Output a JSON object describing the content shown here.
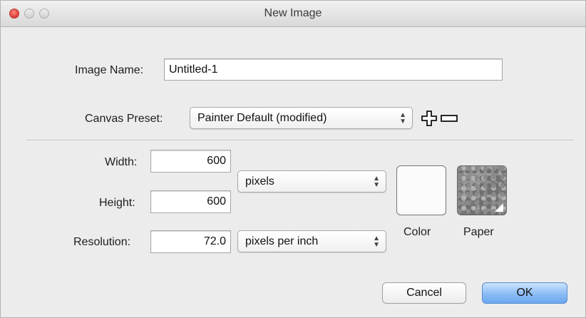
{
  "window": {
    "title": "New Image"
  },
  "form": {
    "image_name_label": "Image Name:",
    "image_name_value": "Untitled-1",
    "canvas_preset_label": "Canvas Preset:",
    "canvas_preset_value": "Painter Default (modified)",
    "width_label": "Width:",
    "width_value": "600",
    "height_label": "Height:",
    "height_value": "600",
    "size_units_value": "pixels",
    "resolution_label": "Resolution:",
    "resolution_value": "72.0",
    "resolution_units_value": "pixels per inch",
    "color_label": "Color",
    "paper_label": "Paper"
  },
  "buttons": {
    "cancel": "Cancel",
    "ok": "OK"
  },
  "icons": {
    "close": "close-icon",
    "minimize": "minimize-icon",
    "zoom": "zoom-icon",
    "add_preset": "plus-icon",
    "remove_preset": "minus-icon",
    "select_arrows": "updown-arrows-icon"
  },
  "colors": {
    "close_button": "#e0443e",
    "ok_button": "#8cbcf5",
    "color_swatch": "#fbfbfb"
  }
}
